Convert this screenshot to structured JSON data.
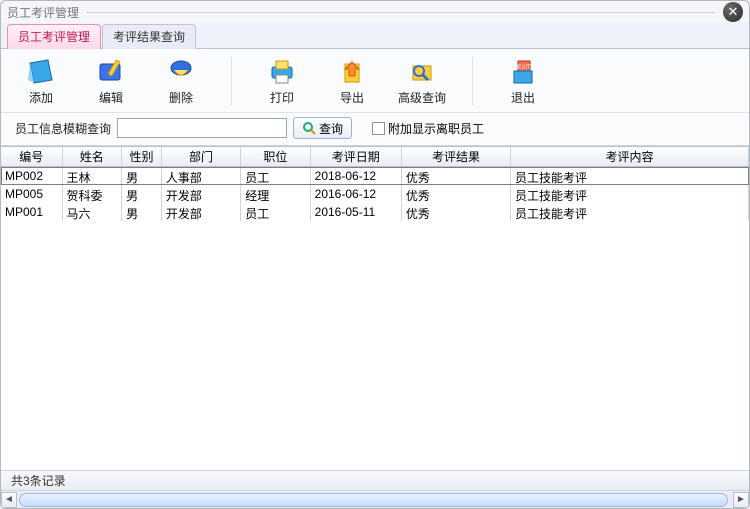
{
  "window": {
    "title": "员工考评管理"
  },
  "tabs": [
    {
      "label": "员工考评管理",
      "active": true
    },
    {
      "label": "考评结果查询",
      "active": false
    }
  ],
  "toolbar": {
    "add": "添加",
    "edit": "编辑",
    "delete": "删除",
    "print": "打印",
    "export": "导出",
    "adv_query": "高级查询",
    "exit": "退出"
  },
  "search": {
    "label": "员工信息模糊查询",
    "value": "",
    "button": "查询",
    "show_left_label": "附加显示离职员工",
    "show_left_checked": false
  },
  "columns": [
    "编号",
    "姓名",
    "性别",
    "部门",
    "职位",
    "考评日期",
    "考评结果",
    "考评内容"
  ],
  "rows": [
    {
      "id": "MP002",
      "name": "王林",
      "gender": "男",
      "dept": "人事部",
      "pos": "员工",
      "date": "2018-06-12",
      "result": "优秀",
      "content": "员工技能考评",
      "selected": true
    },
    {
      "id": "MP005",
      "name": "贺科委",
      "gender": "男",
      "dept": "开发部",
      "pos": "经理",
      "date": "2016-06-12",
      "result": "优秀",
      "content": "员工技能考评",
      "selected": false
    },
    {
      "id": "MP001",
      "name": "马六",
      "gender": "男",
      "dept": "开发部",
      "pos": "员工",
      "date": "2016-05-11",
      "result": "优秀",
      "content": "员工技能考评",
      "selected": false
    }
  ],
  "status": {
    "count_text": "共3条记录"
  }
}
